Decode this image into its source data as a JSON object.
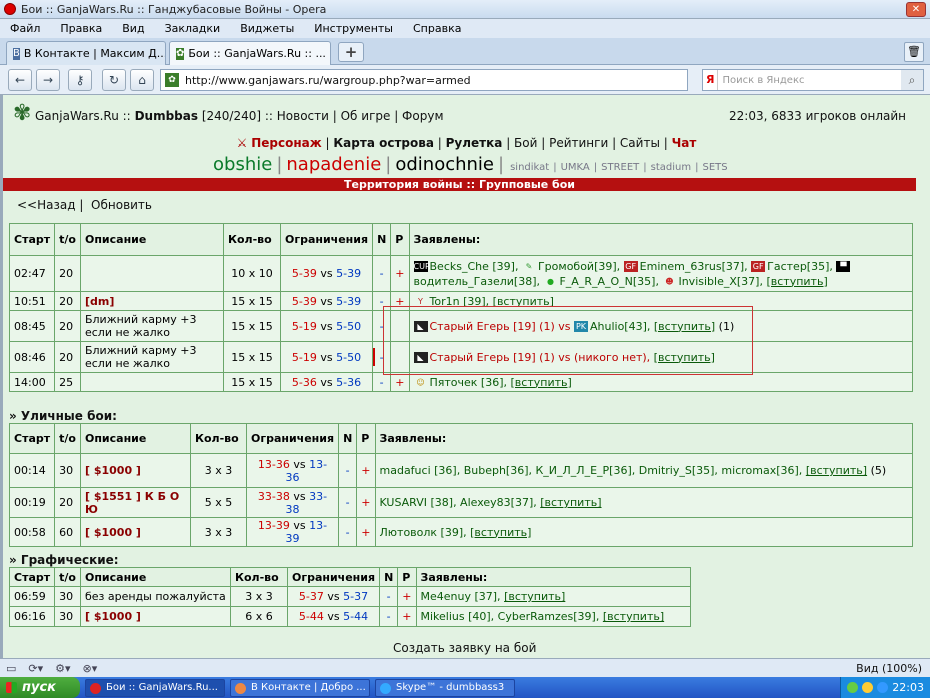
{
  "window": {
    "title": "Бои :: GanjaWars.Ru :: Ганджубасовые Войны - Opera"
  },
  "menu": [
    "Файл",
    "Правка",
    "Вид",
    "Закладки",
    "Виджеты",
    "Инструменты",
    "Справка"
  ],
  "tabs": [
    {
      "label": "В Контакте | Максим Д..."
    },
    {
      "label": "Бои :: GanjaWars.Ru :: ..."
    }
  ],
  "address": {
    "url": "http://www.ganjawars.ru/wargroup.php?war=armed"
  },
  "search": {
    "engine": "Я",
    "placeholder": "Поиск в Яндекс"
  },
  "header": {
    "site": "GanjaWars.Ru",
    "sep": "::",
    "user": "Dumbbas",
    "hp": "[240/240]",
    "links": ":: Новости | Об игре | Форум",
    "status": "22:03, 6833 игроков онлайн"
  },
  "mainnav": {
    "items": [
      "Персонаж",
      "Карта острова",
      "Рулетка",
      "Бой",
      "Рейтинги",
      "Сайты",
      "Чат"
    ]
  },
  "warnav": {
    "obshie": "obshie",
    "napadenie": "napadenie",
    "odinochnie": "odinochnie",
    "small": [
      "sindikat",
      "UMKA",
      "STREET",
      "stadium",
      "SETS"
    ]
  },
  "banner": "Территория войны :: Групповые бои",
  "back": {
    "back": "<<Назад",
    "refresh": "Обновить"
  },
  "headers": {
    "start": "Старт",
    "to": "t/o",
    "desc": "Описание",
    "count": "Кол-во",
    "limits": "Ограничения",
    "n": "N",
    "p": "P",
    "applied": "Заявлены:"
  },
  "group_rows": [
    {
      "start": "02:47",
      "to": "20",
      "desc": "",
      "count": "10 x 10",
      "l1": "5-39",
      "vs": "vs",
      "l2": "5-39",
      "n": "-",
      "p": "+",
      "players": [
        {
          "icon": "CURR",
          "ic": "#000",
          "name": "Becks_Che [39],"
        },
        {
          "icon": "✎",
          "ic": "#393",
          "name": "Громобой[39],"
        },
        {
          "icon": "GF",
          "ic": "#b22",
          "name": "Eminem_63rus[37],"
        },
        {
          "icon": "GF",
          "ic": "#b22",
          "name": "Гастер[35],"
        },
        {
          "icon": "▀",
          "ic": "#000",
          "name": "водитель_Газели[38],"
        },
        {
          "icon": "●",
          "ic": "#2a2",
          "name": "F_A_R_A_O_N[35],"
        },
        {
          "icon": "☻",
          "ic": "#c22",
          "name": "Invisible_X[37],"
        }
      ],
      "join": "[вступить]"
    },
    {
      "start": "10:51",
      "to": "20",
      "desc": "[dm]",
      "count": "15 x 15",
      "l1": "5-39",
      "vs": "vs",
      "l2": "5-39",
      "n": "-",
      "p": "+",
      "players": [
        {
          "icon": "Y",
          "ic": "#b22",
          "name": "Tor1n [39],"
        }
      ],
      "join": "[вступить]"
    },
    {
      "start": "08:45",
      "to": "20",
      "desc": "Ближний карму +3 если не жалко",
      "count": "15 x 15",
      "l1": "5-19",
      "vs": "vs",
      "l2": "5-50",
      "n": "-",
      "p": "",
      "players": [
        {
          "icon": "◣",
          "ic": "#222",
          "name": "Старый Егерь [19] (1) vs"
        },
        {
          "icon": "PK",
          "ic": "#28a",
          "name": "Ahulio[43],"
        }
      ],
      "join": "[вступить]",
      "tail": "(1)"
    },
    {
      "start": "08:46",
      "to": "20",
      "desc": "Ближний карму +3 если не жалко",
      "count": "15 x 15",
      "l1": "5-19",
      "vs": "vs",
      "l2": "5-50",
      "n": "-",
      "p": "",
      "players": [
        {
          "icon": "◣",
          "ic": "#222",
          "name": "Старый Егерь [19] (1) vs (никого нет),"
        }
      ],
      "join": "[вступить]",
      "tail": ""
    },
    {
      "start": "14:00",
      "to": "25",
      "desc": "",
      "count": "15 x 15",
      "l1": "5-36",
      "vs": "vs",
      "l2": "5-36",
      "n": "-",
      "p": "+",
      "players": [
        {
          "icon": "☺",
          "ic": "#b80",
          "name": "Пяточек [36],"
        }
      ],
      "join": "[вступить]"
    }
  ],
  "street": {
    "title": "» Уличные бои:",
    "rows": [
      {
        "start": "00:14",
        "to": "30",
        "desc": "[ $1000 ]",
        "count": "3 x 3",
        "l1": "13-36",
        "vs": "vs",
        "l2": "13-36",
        "n": "-",
        "p": "+",
        "players": "madafuci [36], Bubeph[36], К_И_Л_Л_Е_Р[36], Dmitriy_S[35], micromax[36],",
        "join": "[вступить]",
        "tail": "(5)"
      },
      {
        "start": "00:19",
        "to": "20",
        "desc": "[ $1551 ] К Б О Ю",
        "count": "5 x 5",
        "l1": "33-38",
        "vs": "vs",
        "l2": "33-38",
        "n": "-",
        "p": "+",
        "players": "KUSARVI [38], Alexey83[37],",
        "join": "[вступить]",
        "tail": ""
      },
      {
        "start": "00:58",
        "to": "60",
        "desc": "[ $1000 ]",
        "count": "3 x 3",
        "l1": "13-39",
        "vs": "vs",
        "l2": "13-39",
        "n": "-",
        "p": "+",
        "players": "Лютоволк [39],",
        "join": "[вступить]",
        "tail": ""
      }
    ]
  },
  "graphic": {
    "title": "» Графические:",
    "rows": [
      {
        "start": "06:59",
        "to": "30",
        "desc": "без аренды пожалуйста",
        "count": "3 x 3",
        "l1": "5-37",
        "vs": "vs",
        "l2": "5-37",
        "n": "-",
        "p": "+",
        "players": "Me4enuy [37],",
        "join": "[вступить]"
      },
      {
        "start": "06:16",
        "to": "30",
        "desc": "[ $1000 ]",
        "count": "6 x 6",
        "l1": "5-44",
        "vs": "vs",
        "l2": "5-44",
        "n": "-",
        "p": "+",
        "players": "Mikelius [40], CyberRamzes[39],",
        "join": "[вступить]"
      }
    ]
  },
  "create": "Создать заявку на бой",
  "statusbar": {
    "zoom": "Вид (100%)"
  },
  "taskbar": {
    "start": "пуск",
    "tasks": [
      "Бои :: GanjaWars.Ru...",
      "В Контакте | Добро ...",
      "Skype™ - dumbbass3"
    ],
    "clock": "22:03"
  },
  "colors": {
    "banner": "#b51010",
    "page_bg": "#e2f2e2",
    "border": "#6aa66a"
  }
}
